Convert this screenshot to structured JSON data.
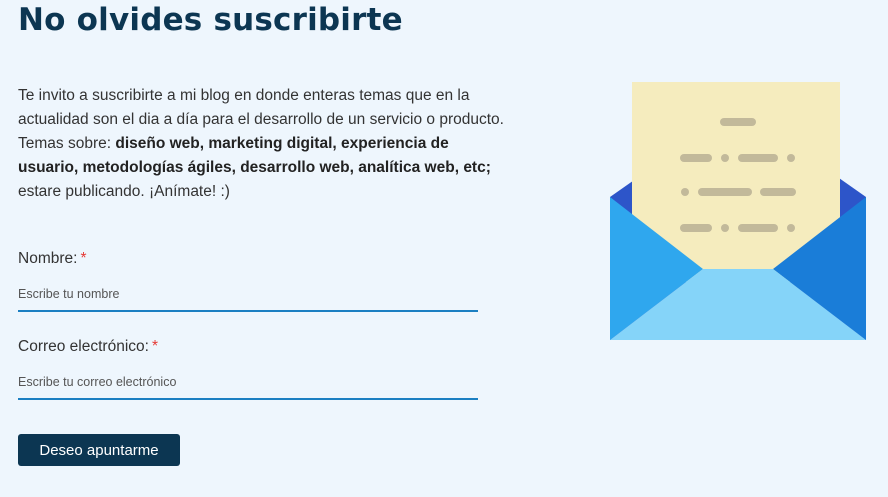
{
  "title": "No olvides suscribirte",
  "intro": {
    "line1": "Te invito a suscribirte a mi blog en donde enteras temas que en la actualidad son el dia a día para el desarrollo de un servicio o producto.",
    "topics_prefix": "Temas sobre: ",
    "topics_bold": "diseño web, marketing digital, experiencia de usuario, metodologías ágiles, desarrollo web, analítica web, etc;",
    "closing": " estare publicando. ¡Anímate! :)"
  },
  "form": {
    "name_label": "Nombre:",
    "name_placeholder": "Escribe tu nombre",
    "email_label": "Correo electrónico:",
    "email_placeholder": "Escribe tu correo electrónico",
    "required_mark": "*",
    "submit_label": "Deseo apuntarme"
  },
  "illustration": {
    "icon": "envelope-letter-icon",
    "colors": {
      "paper": "#f5ecbe",
      "lines": "#c2b99a",
      "flap_dark": "#2d55c9",
      "side_left": "#2fa7ee",
      "side_right": "#1a7dd8",
      "front": "#85d4f9"
    }
  },
  "colors": {
    "background": "#eef6fd",
    "title": "#0c3652",
    "accent": "#1b7fc2",
    "button": "#0c3652",
    "required": "#e53935"
  }
}
